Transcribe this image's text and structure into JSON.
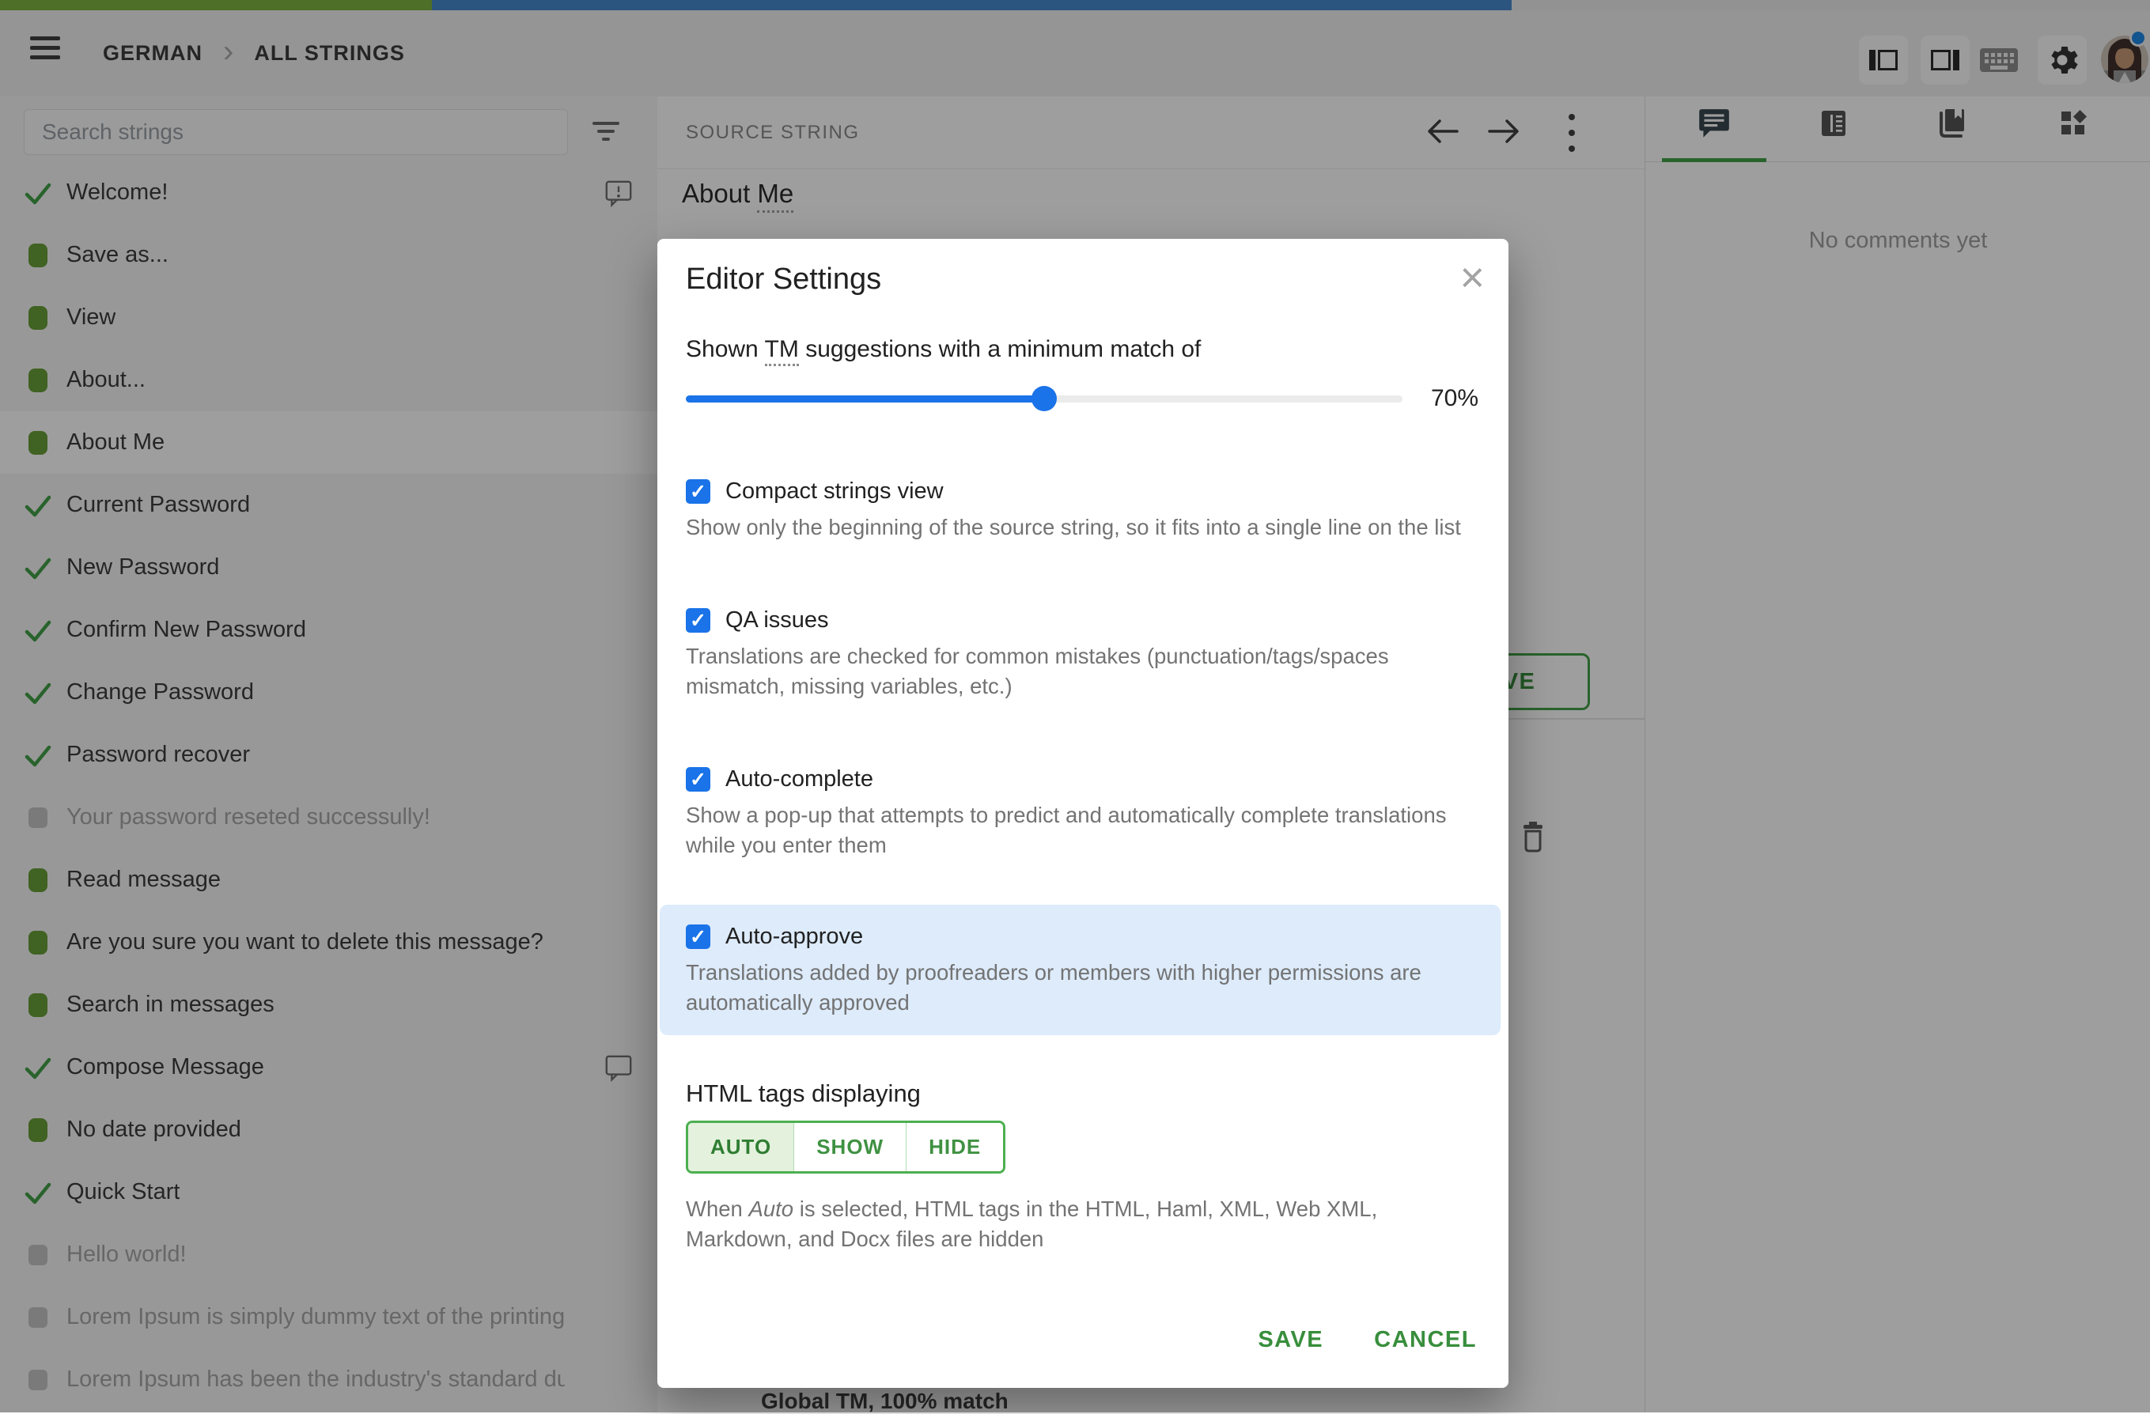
{
  "chrome": {
    "breadcrumb": {
      "project": "GERMAN",
      "section": "ALL STRINGS"
    },
    "progress": {
      "translated_fraction": 0.201,
      "approved_fraction": 0.502
    },
    "toolbar_icons": [
      "left-panel-layout",
      "right-panel-layout",
      "keyboard",
      "settings-gear",
      "avatar"
    ]
  },
  "sidebar": {
    "search": {
      "placeholder": "Search strings"
    },
    "items": [
      {
        "label": "Welcome!",
        "status": "approved",
        "comment": "issue",
        "selected": false
      },
      {
        "label": "Save as...",
        "status": "translated",
        "comment": "",
        "selected": false
      },
      {
        "label": "View",
        "status": "translated",
        "comment": "",
        "selected": false
      },
      {
        "label": "About...",
        "status": "translated",
        "comment": "",
        "selected": false
      },
      {
        "label": "About Me",
        "status": "translated",
        "comment": "",
        "selected": true
      },
      {
        "label": "Current Password",
        "status": "approved",
        "comment": "",
        "selected": false
      },
      {
        "label": "New Password",
        "status": "approved",
        "comment": "",
        "selected": false
      },
      {
        "label": "Confirm New Password",
        "status": "approved",
        "comment": "",
        "selected": false
      },
      {
        "label": "Change Password",
        "status": "approved",
        "comment": "",
        "selected": false
      },
      {
        "label": "Password recover",
        "status": "approved",
        "comment": "",
        "selected": false
      },
      {
        "label": "Your password reseted successully!",
        "status": "inactive",
        "comment": "",
        "selected": false
      },
      {
        "label": "Read message",
        "status": "translated",
        "comment": "",
        "selected": false
      },
      {
        "label": "Are you sure you want to delete this message?",
        "status": "translated",
        "comment": "",
        "selected": false
      },
      {
        "label": "Search in messages",
        "status": "translated",
        "comment": "",
        "selected": false
      },
      {
        "label": "Compose Message",
        "status": "approved",
        "comment": "plain",
        "selected": false
      },
      {
        "label": "No date provided",
        "status": "translated",
        "comment": "",
        "selected": false
      },
      {
        "label": "Quick Start",
        "status": "approved",
        "comment": "",
        "selected": false
      },
      {
        "label": "Hello world!",
        "status": "inactive",
        "comment": "",
        "selected": false
      },
      {
        "label": "Lorem Ipsum is simply dummy text of the printing and ty…",
        "status": "inactive",
        "comment": "",
        "selected": false
      },
      {
        "label": "Lorem Ipsum has been the industry's standard dummy t…",
        "status": "inactive",
        "comment": "",
        "selected": false
      }
    ]
  },
  "editor": {
    "source_label": "SOURCE STRING",
    "source_text_before": "About ",
    "source_text_underlined": "Me",
    "save_label": "SAVE",
    "tm_match": "Global TM, 100% match"
  },
  "comments_panel": {
    "empty_text": "No comments yet"
  },
  "modal": {
    "title": "Editor Settings",
    "close_glyph": "×",
    "tm_slider": {
      "label_before": "Shown ",
      "label_term": "TM",
      "label_after": " suggestions with a minimum match of",
      "value": "70%",
      "thumb_fraction": 0.5
    },
    "sections": [
      {
        "label": "Compact strings view",
        "checked": true,
        "desc": "Show only the beginning of the source string, so it fits into a single line on the list"
      },
      {
        "label": "QA issues",
        "checked": true,
        "desc": "Translations are checked for common mistakes (punctuation/tags/spaces mismatch, missing variables, etc.)"
      },
      {
        "label": "Auto-complete",
        "checked": true,
        "desc": "Show a pop-up that attempts to predict and automatically complete translations while you enter them"
      },
      {
        "label": "Auto-approve",
        "checked": true,
        "highlighted": true,
        "desc": "Translations added by proofreaders or members with higher permissions are automatically approved"
      }
    ],
    "html_tags": {
      "heading": "HTML tags displaying",
      "options": [
        "AUTO",
        "SHOW",
        "HIDE"
      ],
      "selected": "AUTO",
      "desc_before": "When ",
      "desc_italic": "Auto",
      "desc_after": " is selected, HTML tags in the HTML, Haml, XML, Web XML, Markdown, and Docx files are hidden"
    },
    "actions": {
      "save": "SAVE",
      "cancel": "CANCEL"
    }
  },
  "colors": {
    "progress_green": "#7cb342",
    "progress_blue": "#4689cc",
    "accent_green": "#43a047",
    "checkbox_blue": "#1a73e8",
    "highlight_blue": "#ddebfb",
    "overlay": "rgba(0,0,0,0.38)"
  }
}
